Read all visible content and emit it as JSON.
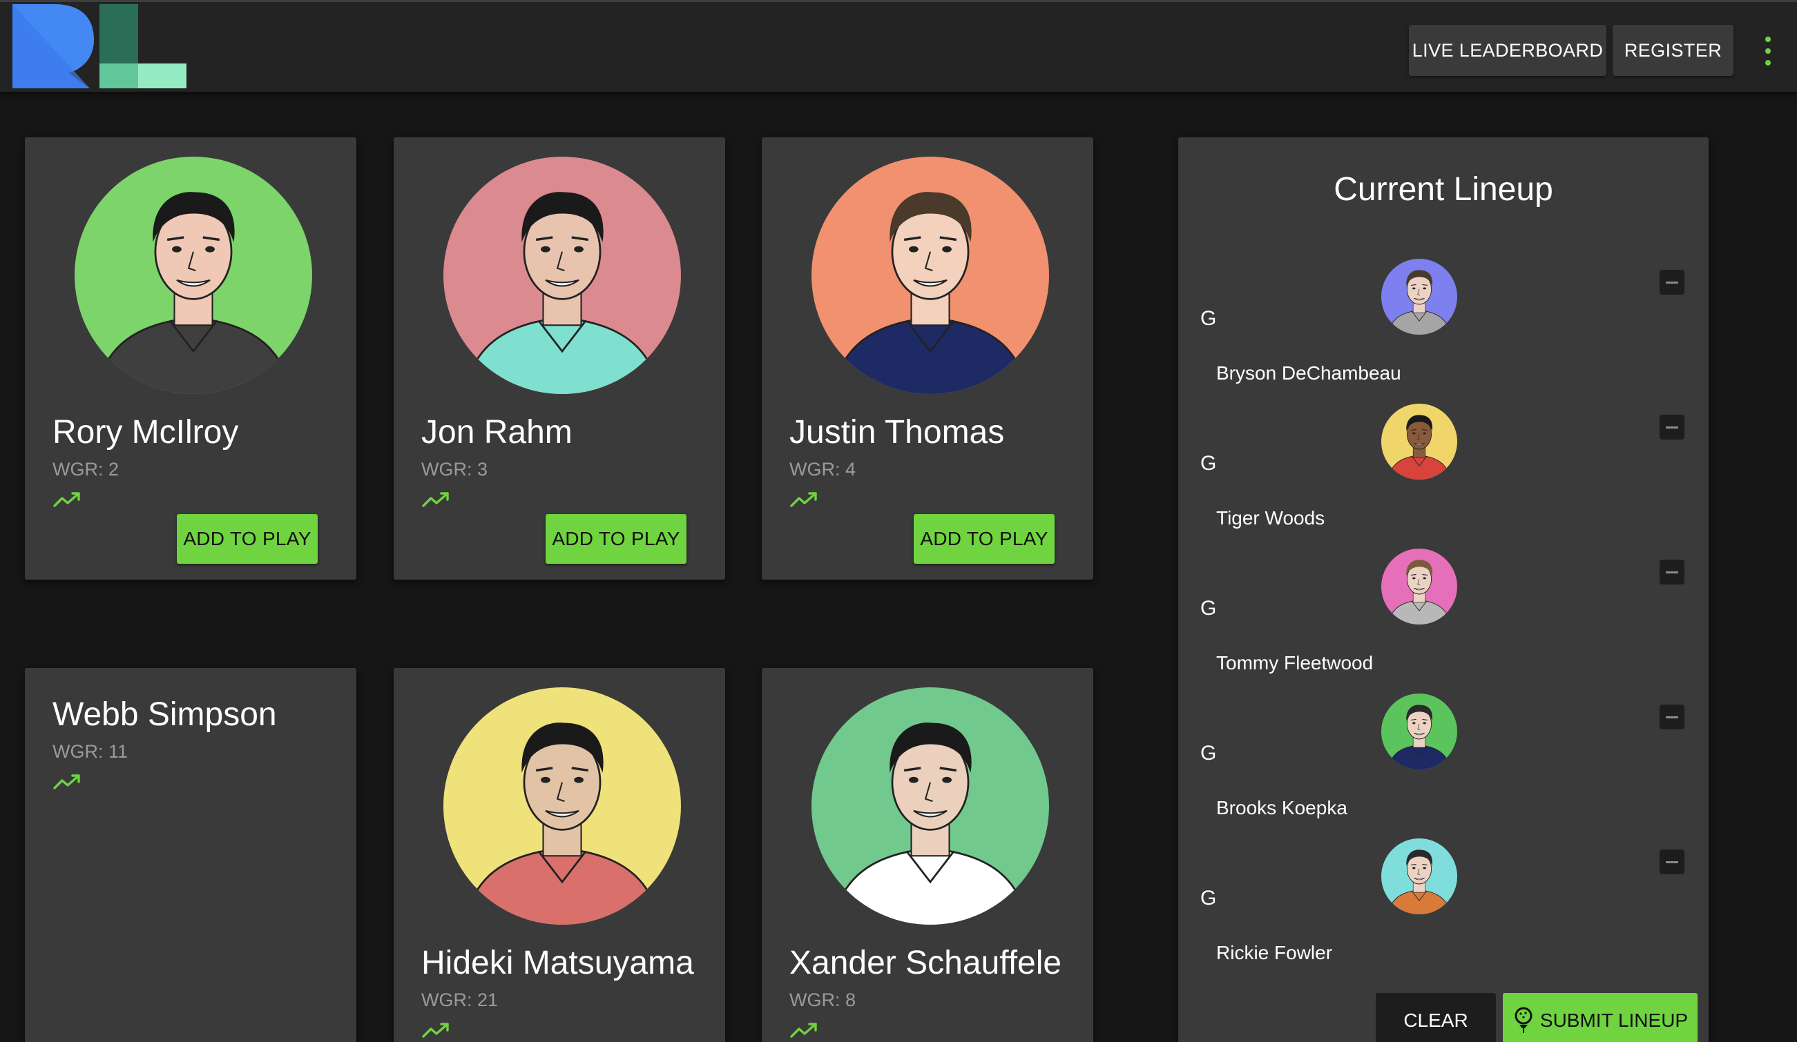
{
  "header": {
    "logo_text": "RL",
    "nav": {
      "live_leaderboard": "LIVE LEADERBOARD",
      "register": "REGISTER"
    },
    "menu_icon": "more-vertical-icon"
  },
  "colors": {
    "accent": "#6fd43f",
    "background": "#161616",
    "appbar": "#232323",
    "card": "#3a3a3a",
    "muted_text": "#9a9a9a"
  },
  "players": [
    {
      "name": "Rory McIlroy",
      "wgr": "WGR: 2",
      "add_label": "ADD TO PLAY",
      "bg": "#7dd46a",
      "shirt": "#3f3f3f",
      "skin": "#f0c8b6",
      "hair": "#1a1a1a",
      "trend_icon": "trending-up-icon"
    },
    {
      "name": "Jon Rahm",
      "wgr": "WGR: 3",
      "add_label": "ADD TO PLAY",
      "bg": "#db8a8f",
      "shirt": "#7fe0cf",
      "skin": "#e8c4ae",
      "hair": "#1a1a1a",
      "trend_icon": "trending-up-icon"
    },
    {
      "name": "Justin Thomas",
      "wgr": "WGR: 4",
      "add_label": "ADD TO PLAY",
      "bg": "#f2916f",
      "shirt": "#1e2a63",
      "skin": "#f3d1bc",
      "hair": "#4a3a2c",
      "trend_icon": "trending-up-icon"
    },
    {
      "name": "Webb Simpson",
      "wgr": "WGR: 11",
      "trend_icon": "trending-up-icon"
    },
    {
      "name": "Hideki Matsuyama",
      "wgr": "WGR: 21",
      "bg": "#f0e27a",
      "shirt": "#d9706b",
      "skin": "#e3c3a6",
      "hair": "#1a1a1a",
      "trend_icon": "trending-up-icon"
    },
    {
      "name": "Xander Schauffele",
      "wgr": "WGR: 8",
      "bg": "#71c98e",
      "shirt": "#ffffff",
      "skin": "#ead0bd",
      "hair": "#1a1a1a",
      "trend_icon": "trending-up-icon"
    }
  ],
  "lineup": {
    "title": "Current Lineup",
    "slots": [
      {
        "pos": "G",
        "name": "Bryson DeChambeau",
        "bg": "#7e80f0",
        "shirt": "#a5a5a5",
        "skin": "#ecd2c2",
        "hair": "#4a3a2c"
      },
      {
        "pos": "G",
        "name": "Tiger Woods",
        "bg": "#f0d66a",
        "shirt": "#d8433c",
        "skin": "#8a5a3c",
        "hair": "#1a1a1a"
      },
      {
        "pos": "G",
        "name": "Tommy Fleetwood",
        "bg": "#e66fb9",
        "shirt": "#b8b8b8",
        "skin": "#ecd2c2",
        "hair": "#7a5a3c"
      },
      {
        "pos": "G",
        "name": "Brooks Koepka",
        "bg": "#5cc45c",
        "shirt": "#1e2a63",
        "skin": "#ecd2c2",
        "hair": "#2a2a2a"
      },
      {
        "pos": "G",
        "name": "Rickie Fowler",
        "bg": "#7fdedc",
        "shirt": "#d77a3a",
        "skin": "#ecd2c2",
        "hair": "#2a2a2a"
      }
    ],
    "clear_label": "CLEAR",
    "submit_label": "SUBMIT LINEUP",
    "remove_icon": "remove-icon",
    "submit_icon": "golf-icon"
  }
}
